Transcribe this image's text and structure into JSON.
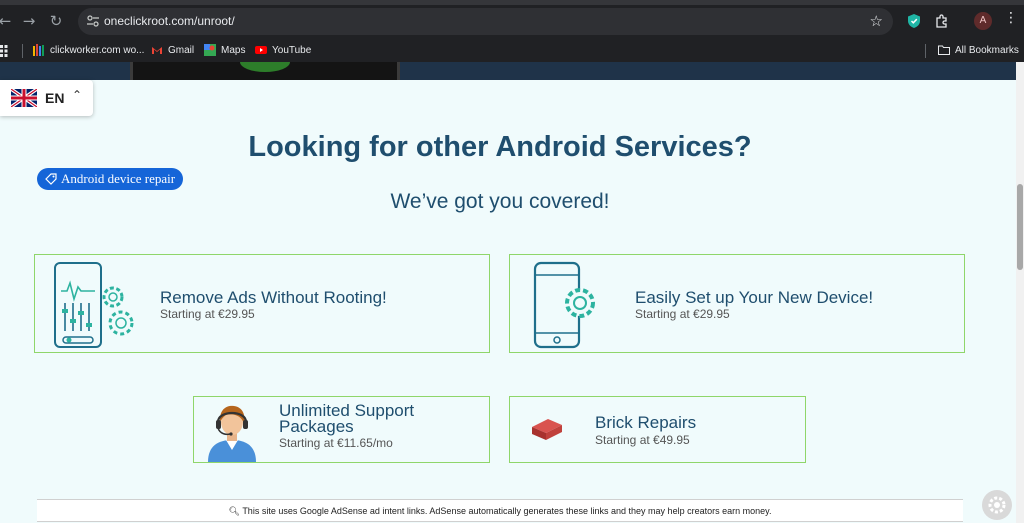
{
  "browser": {
    "url": "oneclickroot.com/unroot/",
    "avatar_letter": "A",
    "bookmarks": [
      {
        "label": "clickworker.com wo...",
        "icon": "clickworker-icon"
      },
      {
        "label": "Gmail",
        "icon": "gmail-icon"
      },
      {
        "label": "Maps",
        "icon": "maps-icon"
      },
      {
        "label": "YouTube",
        "icon": "youtube-icon"
      }
    ],
    "all_bookmarks": "All Bookmarks"
  },
  "language": {
    "code": "EN",
    "flag_icon": "uk-flag-icon"
  },
  "section": {
    "heading": "Looking for other Android Services?",
    "subheading": "We’ve got you covered!",
    "tag_chip": "Android device repair"
  },
  "services": [
    {
      "title": "Remove Ads Without Rooting!",
      "price": "Starting at €29.95",
      "icon": "phone-settings-sliders-icon"
    },
    {
      "title": "Easily Set up Your New Device!",
      "price": "Starting at €29.95",
      "icon": "phone-gear-icon"
    },
    {
      "title": "Unlimited Support Packages",
      "price": "Starting at €11.65/mo",
      "icon": "support-agent-icon"
    },
    {
      "title": "Brick Repairs",
      "price": "Starting at €49.95",
      "icon": "brick-icon"
    }
  ],
  "adsense_notice": "This site uses Google AdSense ad intent links. AdSense automatically generates these links and they may help creators earn money.",
  "colors": {
    "accent_dark_blue": "#1f4e6e",
    "card_border": "#8fd66a",
    "chip_blue": "#1565d8",
    "page_bg": "#f0fbfc"
  }
}
